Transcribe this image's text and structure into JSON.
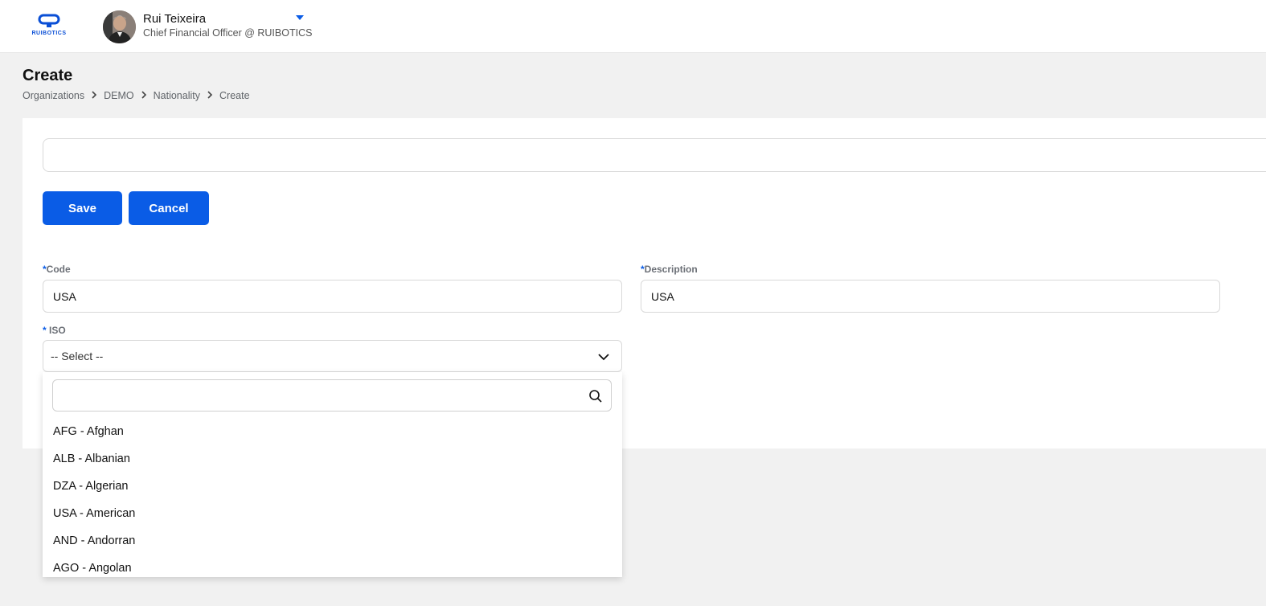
{
  "header": {
    "logo_text": "RUIBOTICS",
    "user_name": "Rui Teixeira",
    "user_role": "Chief Financial Officer @ RUIBOTICS"
  },
  "page": {
    "title": "Create",
    "breadcrumb": [
      "Organizations",
      "DEMO",
      "Nationality",
      "Create"
    ]
  },
  "actions": {
    "save_label": "Save",
    "cancel_label": "Cancel"
  },
  "form": {
    "code_label": "Code",
    "code_value": "USA",
    "description_label": "Description",
    "description_value": "USA",
    "iso_label": " ISO",
    "iso_selected": "-- Select --",
    "required_mark": "*"
  },
  "dropdown": {
    "search_value": "",
    "options": [
      "AFG - Afghan",
      "ALB - Albanian",
      "DZA - Algerian",
      "USA - American",
      "AND - Andorran",
      "AGO - Angolan"
    ]
  },
  "colors": {
    "accent": "#0a5ce6",
    "background": "#f1f1f1",
    "card": "#ffffff"
  }
}
